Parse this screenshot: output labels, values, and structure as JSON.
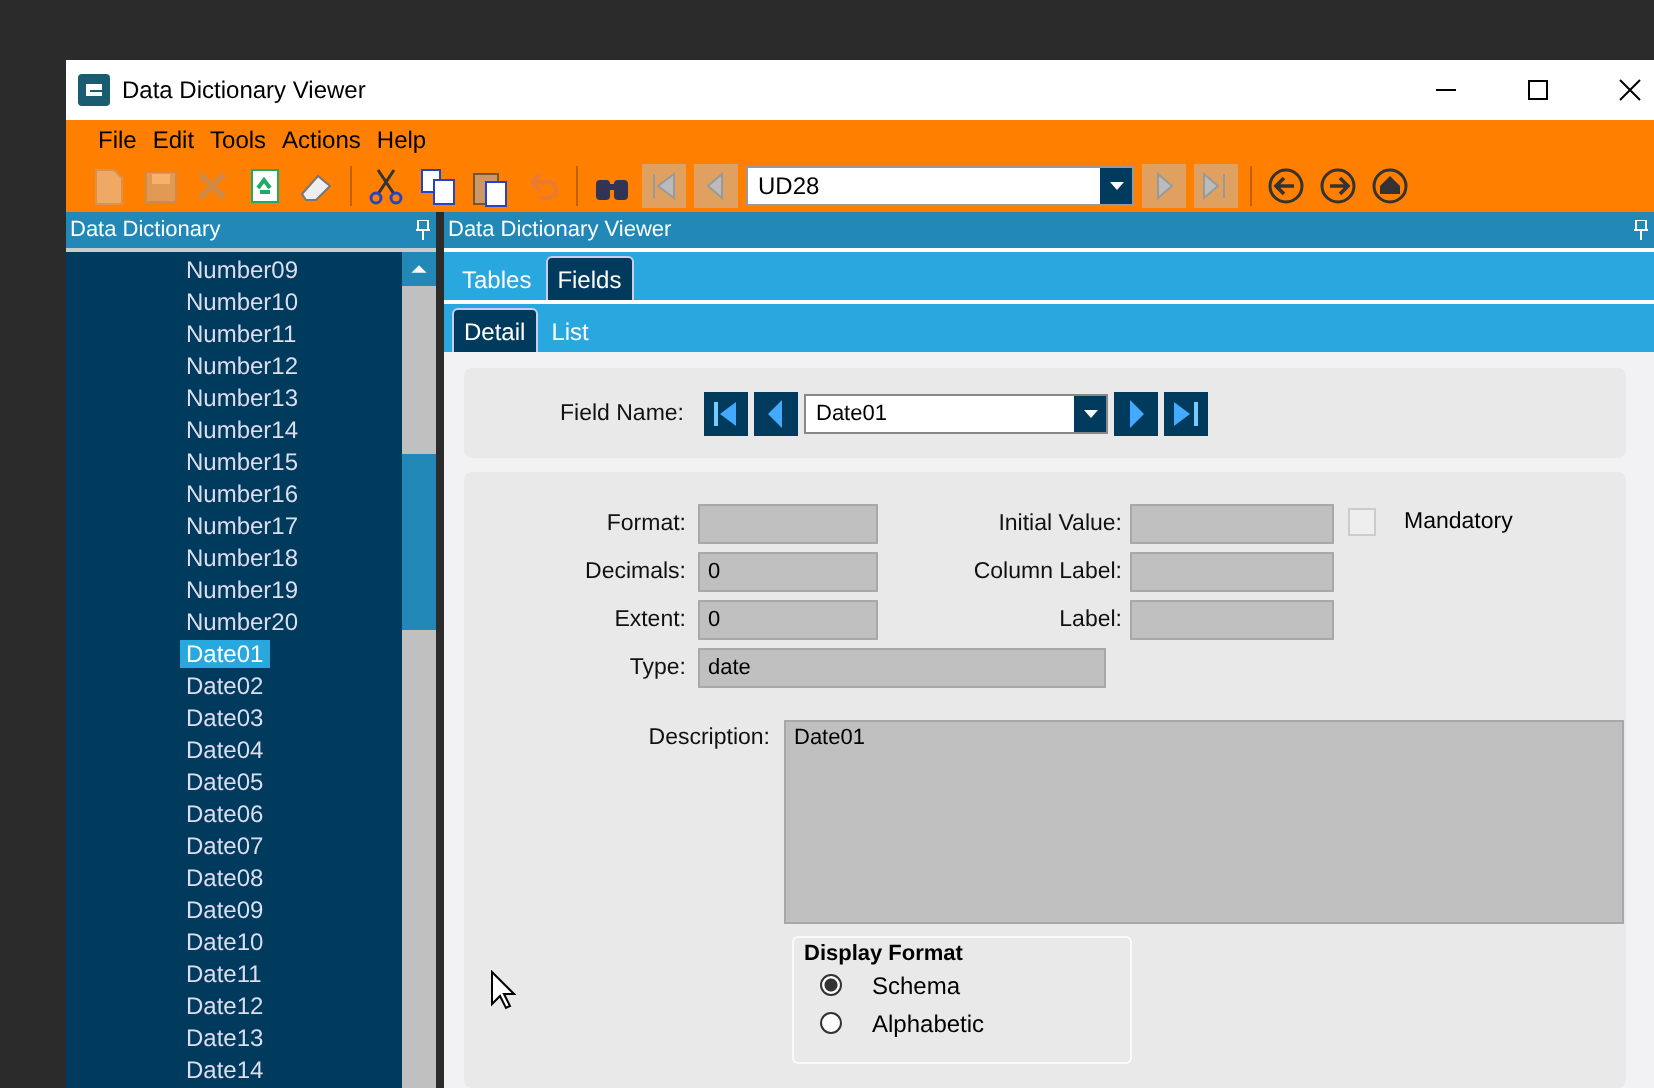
{
  "window": {
    "title": "Data Dictionary Viewer"
  },
  "menu": [
    "File",
    "Edit",
    "Tools",
    "Actions",
    "Help"
  ],
  "toolbar": [
    {
      "kind": "new",
      "disabled": true
    },
    {
      "kind": "save",
      "disabled": true
    },
    {
      "kind": "delete",
      "disabled": true
    },
    {
      "kind": "refresh",
      "disabled": false
    },
    {
      "kind": "clear",
      "disabled": false
    },
    {
      "kind": "sep"
    },
    {
      "kind": "cut",
      "disabled": false
    },
    {
      "kind": "copy",
      "disabled": false
    },
    {
      "kind": "paste",
      "disabled": false
    },
    {
      "kind": "undo",
      "disabled": true
    },
    {
      "kind": "sep"
    },
    {
      "kind": "find",
      "disabled": false
    },
    {
      "kind": "first",
      "disabled": true
    },
    {
      "kind": "prev",
      "disabled": true
    },
    {
      "kind": "combo"
    },
    {
      "kind": "next",
      "disabled": true
    },
    {
      "kind": "last",
      "disabled": true
    },
    {
      "kind": "sep"
    },
    {
      "kind": "back",
      "disabled": false
    },
    {
      "kind": "forward",
      "disabled": false
    },
    {
      "kind": "home",
      "disabled": false
    }
  ],
  "table_combo": {
    "value": "UD28"
  },
  "sidebar": {
    "title": "Data Dictionary",
    "items": [
      {
        "label": "Number09",
        "selected": false
      },
      {
        "label": "Number10",
        "selected": false
      },
      {
        "label": "Number11",
        "selected": false
      },
      {
        "label": "Number12",
        "selected": false
      },
      {
        "label": "Number13",
        "selected": false
      },
      {
        "label": "Number14",
        "selected": false
      },
      {
        "label": "Number15",
        "selected": false
      },
      {
        "label": "Number16",
        "selected": false
      },
      {
        "label": "Number17",
        "selected": false
      },
      {
        "label": "Number18",
        "selected": false
      },
      {
        "label": "Number19",
        "selected": false
      },
      {
        "label": "Number20",
        "selected": false
      },
      {
        "label": "Date01",
        "selected": true
      },
      {
        "label": "Date02",
        "selected": false
      },
      {
        "label": "Date03",
        "selected": false
      },
      {
        "label": "Date04",
        "selected": false
      },
      {
        "label": "Date05",
        "selected": false
      },
      {
        "label": "Date06",
        "selected": false
      },
      {
        "label": "Date07",
        "selected": false
      },
      {
        "label": "Date08",
        "selected": false
      },
      {
        "label": "Date09",
        "selected": false
      },
      {
        "label": "Date10",
        "selected": false
      },
      {
        "label": "Date11",
        "selected": false
      },
      {
        "label": "Date12",
        "selected": false
      },
      {
        "label": "Date13",
        "selected": false
      },
      {
        "label": "Date14",
        "selected": false
      }
    ]
  },
  "main": {
    "title": "Data Dictionary Viewer",
    "tabs": [
      {
        "label": "Tables",
        "selected": false
      },
      {
        "label": "Fields",
        "selected": true
      }
    ],
    "subtabs": [
      {
        "label": "Detail",
        "selected": true
      },
      {
        "label": "List",
        "selected": false
      }
    ],
    "field_name": {
      "label": "Field Name:",
      "value": "Date01"
    },
    "left_fields": [
      {
        "label": "Format:"
      },
      {
        "label": "Decimals:",
        "value": "0"
      },
      {
        "label": "Extent:",
        "value": "0"
      }
    ],
    "type_field": {
      "label": "Type:",
      "value": "date"
    },
    "right_fields": [
      {
        "label": "Initial Value:"
      },
      {
        "label": "Column Label:"
      },
      {
        "label": "Label:"
      }
    ],
    "mandatory": {
      "label": "Mandatory",
      "checked": false
    },
    "description": {
      "label": "Description:",
      "value": "Date01"
    },
    "display_format": {
      "title": "Display Format",
      "options": [
        {
          "label": "Schema",
          "selected": true
        },
        {
          "label": "Alphabetic",
          "selected": false
        }
      ]
    }
  }
}
